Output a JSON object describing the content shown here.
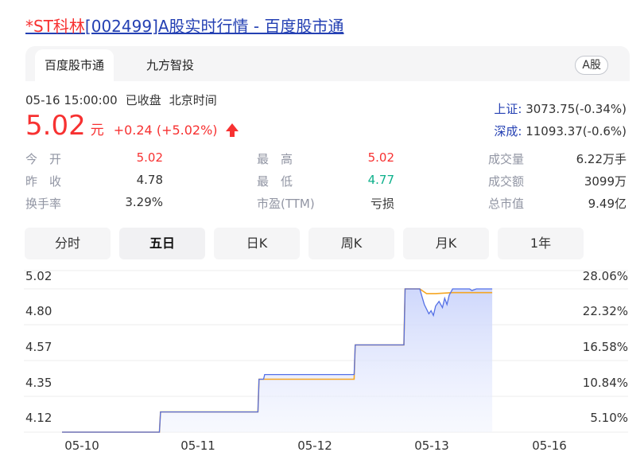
{
  "title": {
    "red": "*ST科林",
    "rest": "[002499]A股实时行情 - 百度股市通"
  },
  "tabs": [
    {
      "label": "百度股市通"
    },
    {
      "label": "九方智投"
    }
  ],
  "badge": "A股",
  "status": {
    "time": "05-16 15:00:00",
    "state": "已收盘",
    "tz": "北京时间"
  },
  "quote": {
    "price": "5.02",
    "unit": "元",
    "change": "+0.24 (+5.02%)"
  },
  "indices": [
    {
      "name": "上证:",
      "value": "3073.75(-0.34%)"
    },
    {
      "name": "深成:",
      "value": "11093.37(-0.6%)"
    }
  ],
  "stats": {
    "open_label": "今　开",
    "open": "5.02",
    "prev_label": "昨　收",
    "prev": "4.78",
    "turnover_label": "换手率",
    "turnover": "3.29%",
    "high_label": "最　高",
    "high": "5.02",
    "low_label": "最　低",
    "low": "4.77",
    "pe_label": "市盈(TTM)",
    "pe": "亏损",
    "vol_label": "成交量",
    "vol": "6.22万手",
    "amt_label": "成交额",
    "amt": "3099万",
    "cap_label": "总市值",
    "cap": "9.49亿"
  },
  "periods": [
    {
      "label": "分时"
    },
    {
      "label": "五日"
    },
    {
      "label": "日K"
    },
    {
      "label": "周K"
    },
    {
      "label": "月K"
    },
    {
      "label": "1年"
    }
  ],
  "colors": {
    "up": "#f73131",
    "down": "#0db08b",
    "price_line": "#5470e6",
    "avg_line": "#f5a623",
    "area": "#dfe5fb",
    "link": "#2440b3"
  },
  "chart_data": {
    "type": "line",
    "y_ticks": [
      "5.02",
      "4.80",
      "4.57",
      "4.35",
      "4.12"
    ],
    "y_right_ticks": [
      "28.06%",
      "22.32%",
      "16.58%",
      "10.84%",
      "5.10%"
    ],
    "x_ticks": [
      "05-10",
      "05-11",
      "05-12",
      "05-13",
      "05-16"
    ],
    "ylim": [
      4.1,
      5.02
    ],
    "days": 5,
    "series": [
      {
        "points": [
          [
            0.0,
            4.1
          ],
          [
            0.86,
            4.1
          ],
          [
            0.87,
            4.23
          ],
          [
            1.0,
            4.23
          ],
          [
            1.73,
            4.23
          ],
          [
            1.74,
            4.44
          ],
          [
            1.78,
            4.44
          ],
          [
            1.79,
            4.47
          ],
          [
            2.0,
            4.47
          ],
          [
            2.58,
            4.47
          ],
          [
            2.59,
            4.66
          ],
          [
            3.0,
            4.66
          ],
          [
            3.02,
            4.66
          ],
          [
            3.03,
            5.02
          ],
          [
            3.16,
            5.02
          ],
          [
            3.18,
            4.97
          ],
          [
            3.2,
            4.92
          ],
          [
            3.22,
            4.89
          ],
          [
            3.24,
            4.86
          ],
          [
            3.26,
            4.88
          ],
          [
            3.28,
            4.85
          ],
          [
            3.3,
            4.91
          ],
          [
            3.33,
            4.94
          ],
          [
            3.36,
            4.9
          ],
          [
            3.38,
            4.96
          ],
          [
            3.4,
            4.92
          ],
          [
            3.42,
            4.98
          ],
          [
            3.45,
            5.02
          ],
          [
            3.6,
            5.02
          ],
          [
            3.62,
            5.01
          ],
          [
            3.66,
            5.02
          ],
          [
            3.8,
            5.02
          ]
        ]
      },
      {
        "points": [
          [
            0.0,
            4.1
          ],
          [
            0.86,
            4.1
          ],
          [
            0.87,
            4.23
          ],
          [
            1.0,
            4.23
          ],
          [
            1.73,
            4.23
          ],
          [
            1.74,
            4.44
          ],
          [
            2.0,
            4.44
          ],
          [
            2.58,
            4.44
          ],
          [
            2.59,
            4.66
          ],
          [
            3.0,
            4.66
          ],
          [
            3.02,
            4.66
          ],
          [
            3.03,
            5.02
          ],
          [
            3.16,
            5.02
          ],
          [
            3.18,
            5.01
          ],
          [
            3.22,
            4.99
          ],
          [
            3.3,
            4.99
          ],
          [
            3.45,
            4.996
          ],
          [
            3.8,
            4.996
          ]
        ]
      }
    ]
  }
}
